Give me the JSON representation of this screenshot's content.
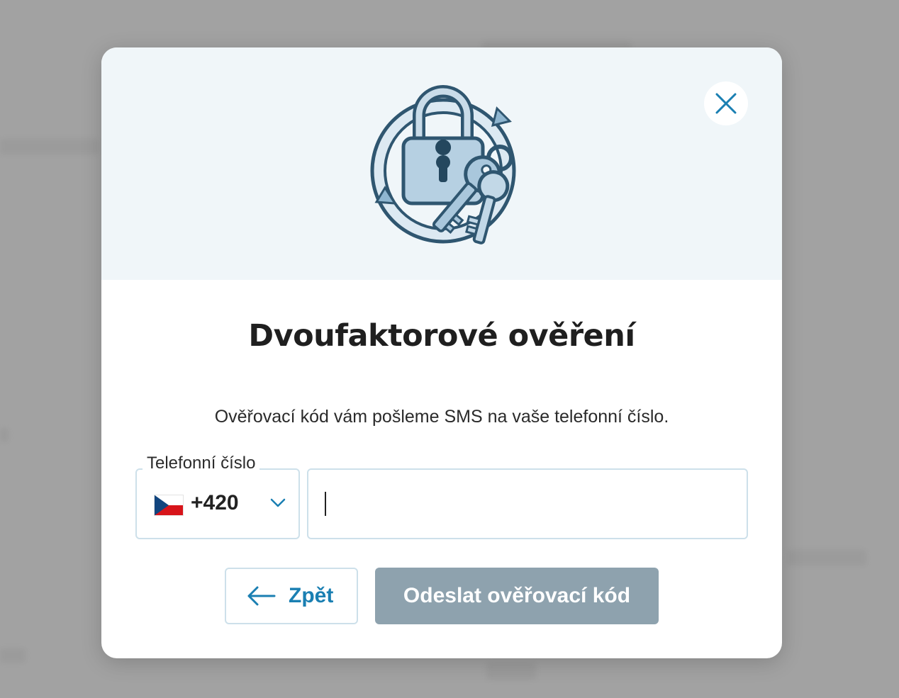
{
  "modal": {
    "title": "Dvoufaktorové ověření",
    "description": "Ověřovací kód vám pošleme SMS na vaše telefonní číslo.",
    "phone_field": {
      "label": "Telefonní číslo",
      "country_flag": "czech-flag",
      "dial_code": "+420",
      "value": "",
      "placeholder": ""
    },
    "buttons": {
      "back_label": "Zpět",
      "submit_label": "Odeslat ověřovací kód"
    },
    "icons": {
      "hero": "lock-keys-icon",
      "close": "close-icon",
      "chevron": "chevron-down-icon",
      "back": "arrow-left-icon"
    }
  },
  "colors": {
    "accent": "#1a7fb2",
    "submit_disabled": "#8ea2ae",
    "header_bg": "#f0f6f9",
    "border": "#cde0ea"
  }
}
